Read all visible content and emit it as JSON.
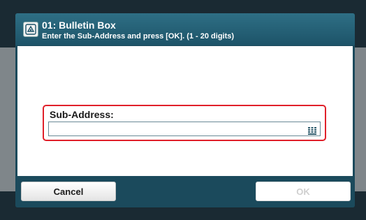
{
  "header": {
    "title": "01: Bulletin Box",
    "subtitle": "Enter the Sub-Address and press [OK]. (1 - 20 digits)",
    "icon": "bulletin-box-icon"
  },
  "form": {
    "label": "Sub-Address:",
    "value": "",
    "keypad_icon": "keypad-icon",
    "highlight_color": "#e0202a"
  },
  "footer": {
    "cancel_label": "Cancel",
    "ok_label": "OK"
  },
  "colors": {
    "header": "#2e6f85",
    "dialog": "#1b4a5c"
  }
}
